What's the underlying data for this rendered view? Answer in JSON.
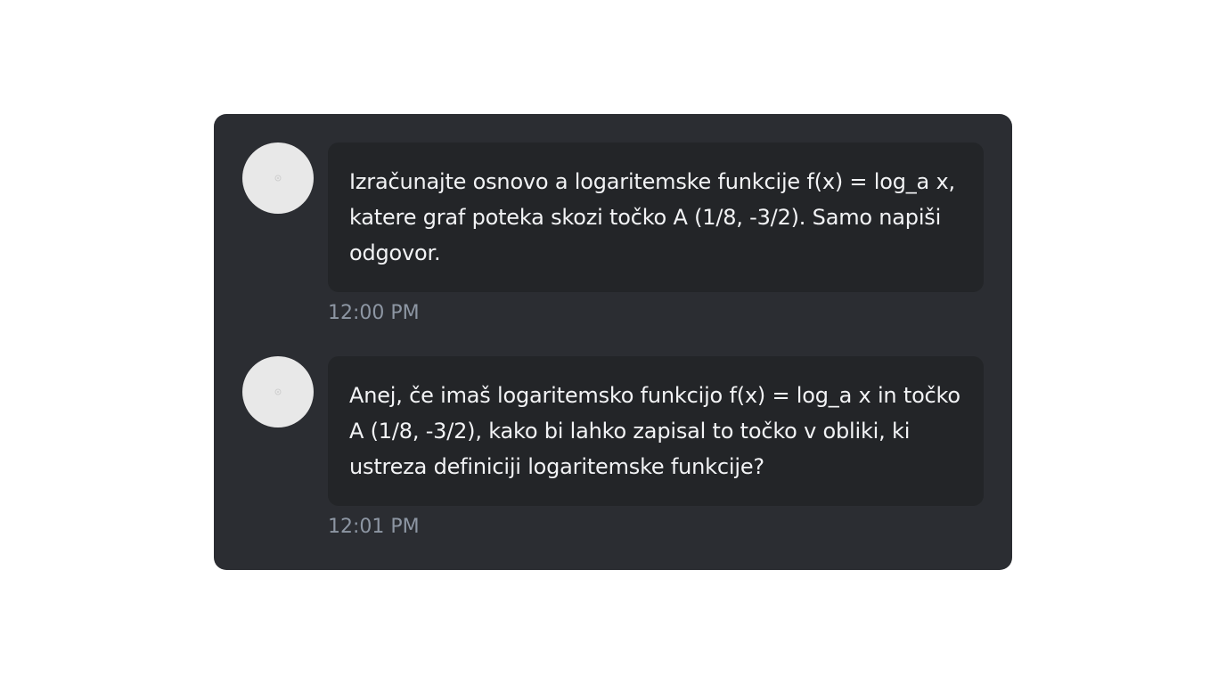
{
  "chat": {
    "messages": [
      {
        "avatar_icon": "user-avatar-icon",
        "text": "Izračunajte osnovo a logaritemske funkcije f(x) = log_a x, katere graf poteka skozi točko A (1/8, -3/2). Samo napiši odgovor.",
        "time": "12:00 PM"
      },
      {
        "avatar_icon": "assistant-avatar-icon",
        "text": "Anej, če imaš logaritemsko funkcijo f(x) = log_a x in točko A (1/8, -3/2), kako bi lahko zapisal to točko v obliki, ki ustreza definiciji logaritemske funkcije?",
        "time": "12:01 PM"
      }
    ]
  },
  "colors": {
    "panel_background": "#2b2d32",
    "bubble_background": "#232528",
    "message_text": "#f2f3f5",
    "timestamp_text": "#8d96a3",
    "avatar_background": "#e8e8e8"
  }
}
